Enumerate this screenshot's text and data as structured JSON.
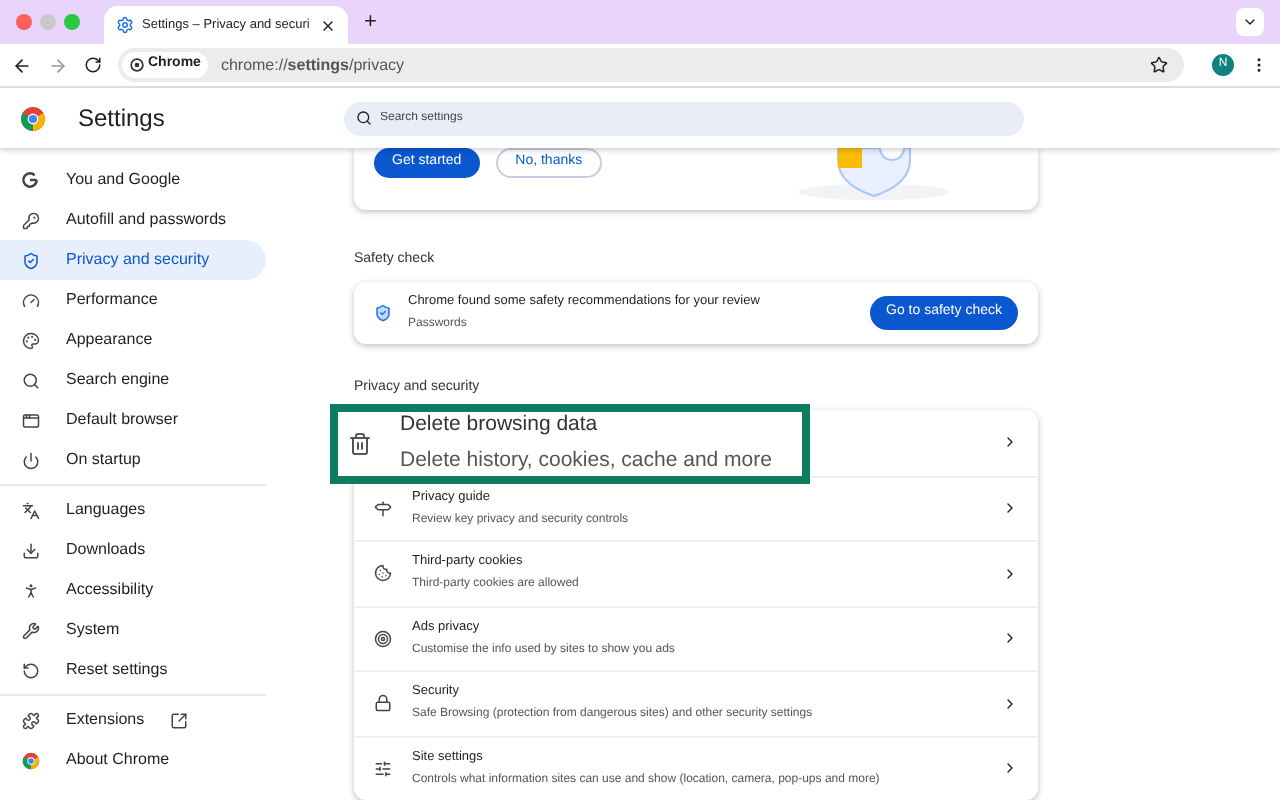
{
  "browser": {
    "tab_title": "Settings – Privacy and securi",
    "new_tab": "+",
    "site_chip": "Chrome",
    "url": "chrome://**settings**/privacy",
    "profile": "N"
  },
  "header": {
    "title": "Settings",
    "search": {
      "placeholder": "Search settings"
    }
  },
  "sidebar": {
    "groups": [
      [
        {
          "label": "You and Google",
          "selected": false
        },
        {
          "label": "Autofill and passwords",
          "selected": false
        },
        {
          "label": "Privacy and security",
          "selected": true
        },
        {
          "label": "Performance",
          "selected": false
        },
        {
          "label": "Appearance",
          "selected": false
        },
        {
          "label": "Search engine",
          "selected": false
        },
        {
          "label": "Default browser",
          "selected": false
        },
        {
          "label": "On startup",
          "selected": false
        }
      ],
      [
        {
          "label": "Languages",
          "selected": false
        },
        {
          "label": "Downloads",
          "selected": false
        },
        {
          "label": "Accessibility",
          "selected": false
        },
        {
          "label": "System",
          "selected": false
        },
        {
          "label": "Reset settings",
          "selected": false
        }
      ],
      [
        {
          "label": "Extensions",
          "selected": false,
          "external": true
        },
        {
          "label": "About Chrome",
          "selected": false
        }
      ]
    ]
  },
  "promo_card": {
    "buttons": [
      {
        "label": "Get started",
        "kind": "primary"
      },
      {
        "label": "No, thanks",
        "kind": "outline"
      }
    ]
  },
  "safety_check": {
    "heading": "Safety check",
    "message": "Chrome found some safety recommendations for your review",
    "detail": "Passwords",
    "button": "Go to safety check"
  },
  "privacy": {
    "heading": "Privacy and security",
    "rows": [
      {
        "title": "Delete browsing data",
        "subtitle": "Delete history, cookies, cache and more",
        "highlighted": true
      },
      {
        "title": "Privacy guide",
        "subtitle": "Review key privacy and security controls",
        "highlighted": false
      },
      {
        "title": "Third-party cookies",
        "subtitle": "Third-party cookies are allowed",
        "highlighted": false
      },
      {
        "title": "Ads privacy",
        "subtitle": "Customise the info used by sites to show you ads",
        "highlighted": false
      },
      {
        "title": "Security",
        "subtitle": "Safe Browsing (protection from dangerous sites) and other security settings",
        "highlighted": false
      },
      {
        "title": "Site settings",
        "subtitle": "Controls what information sites can use and show (location, camera, pop-ups and more)",
        "highlighted": false
      }
    ]
  }
}
